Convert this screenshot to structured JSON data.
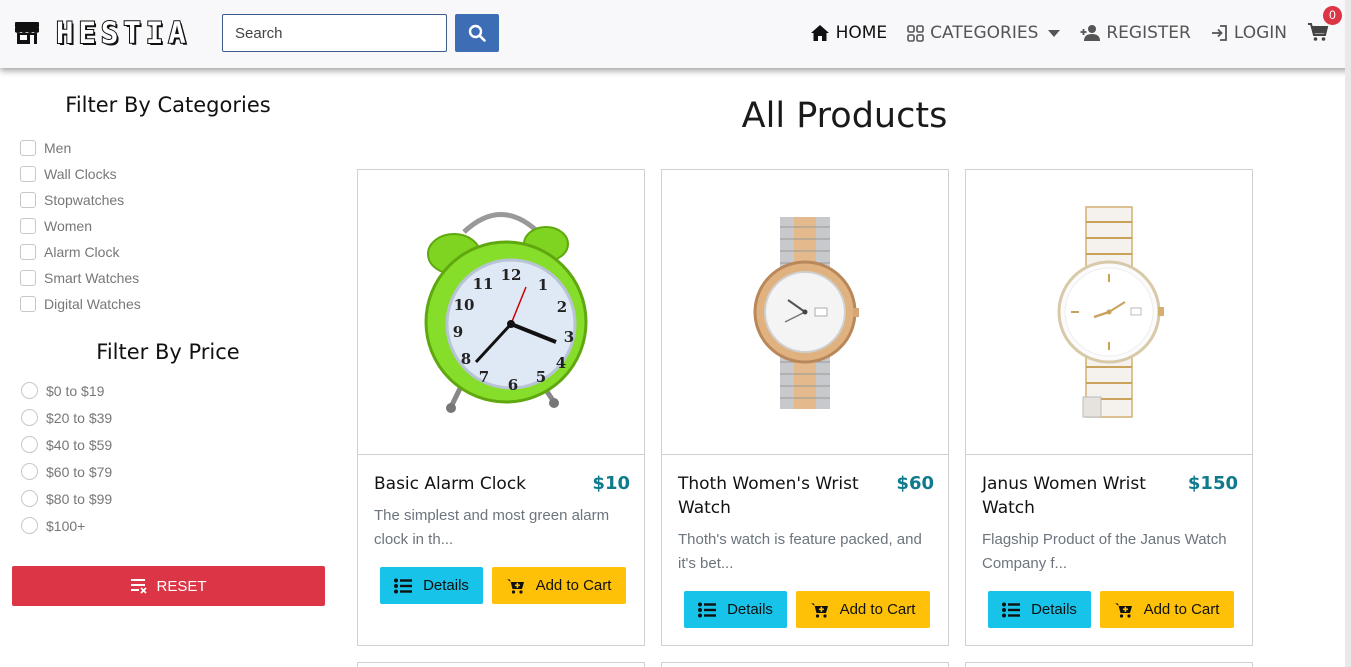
{
  "brand": {
    "name": "HESTIA",
    "icon": "store-icon"
  },
  "search": {
    "placeholder": "Search"
  },
  "nav": {
    "home": "HOME",
    "categories": "CATEGORIES",
    "register": "REGISTER",
    "login": "LOGIN",
    "cart_count": "0"
  },
  "sidebar": {
    "category_title": "Filter By Categories",
    "categories": [
      "Men",
      "Wall Clocks",
      "Stopwatches",
      "Women",
      "Alarm Clock",
      "Smart Watches",
      "Digital Watches"
    ],
    "price_title": "Filter By Price",
    "prices": [
      "$0 to $19",
      "$20 to $39",
      "$40 to $59",
      "$60 to $79",
      "$80 to $99",
      "$100+"
    ],
    "reset_label": "RESET"
  },
  "main": {
    "title": "All Products",
    "details_label": "Details",
    "add_to_cart_label": "Add to Cart",
    "products": [
      {
        "name": "Basic Alarm Clock",
        "price": "$10",
        "description": "The simplest and most green alarm clock in th..."
      },
      {
        "name": "Thoth Women's Wrist Watch",
        "price": "$60",
        "description": "Thoth's watch is feature packed, and it's bet..."
      },
      {
        "name": "Janus Women Wrist Watch",
        "price": "$150",
        "description": "Flagship Product of the Janus Watch Company f..."
      }
    ]
  },
  "colors": {
    "accent": "#3d6db5",
    "price": "#0f7a8c",
    "details_button": "#17c3e8",
    "cart_button": "#ffc107",
    "reset_button": "#dc3545"
  }
}
